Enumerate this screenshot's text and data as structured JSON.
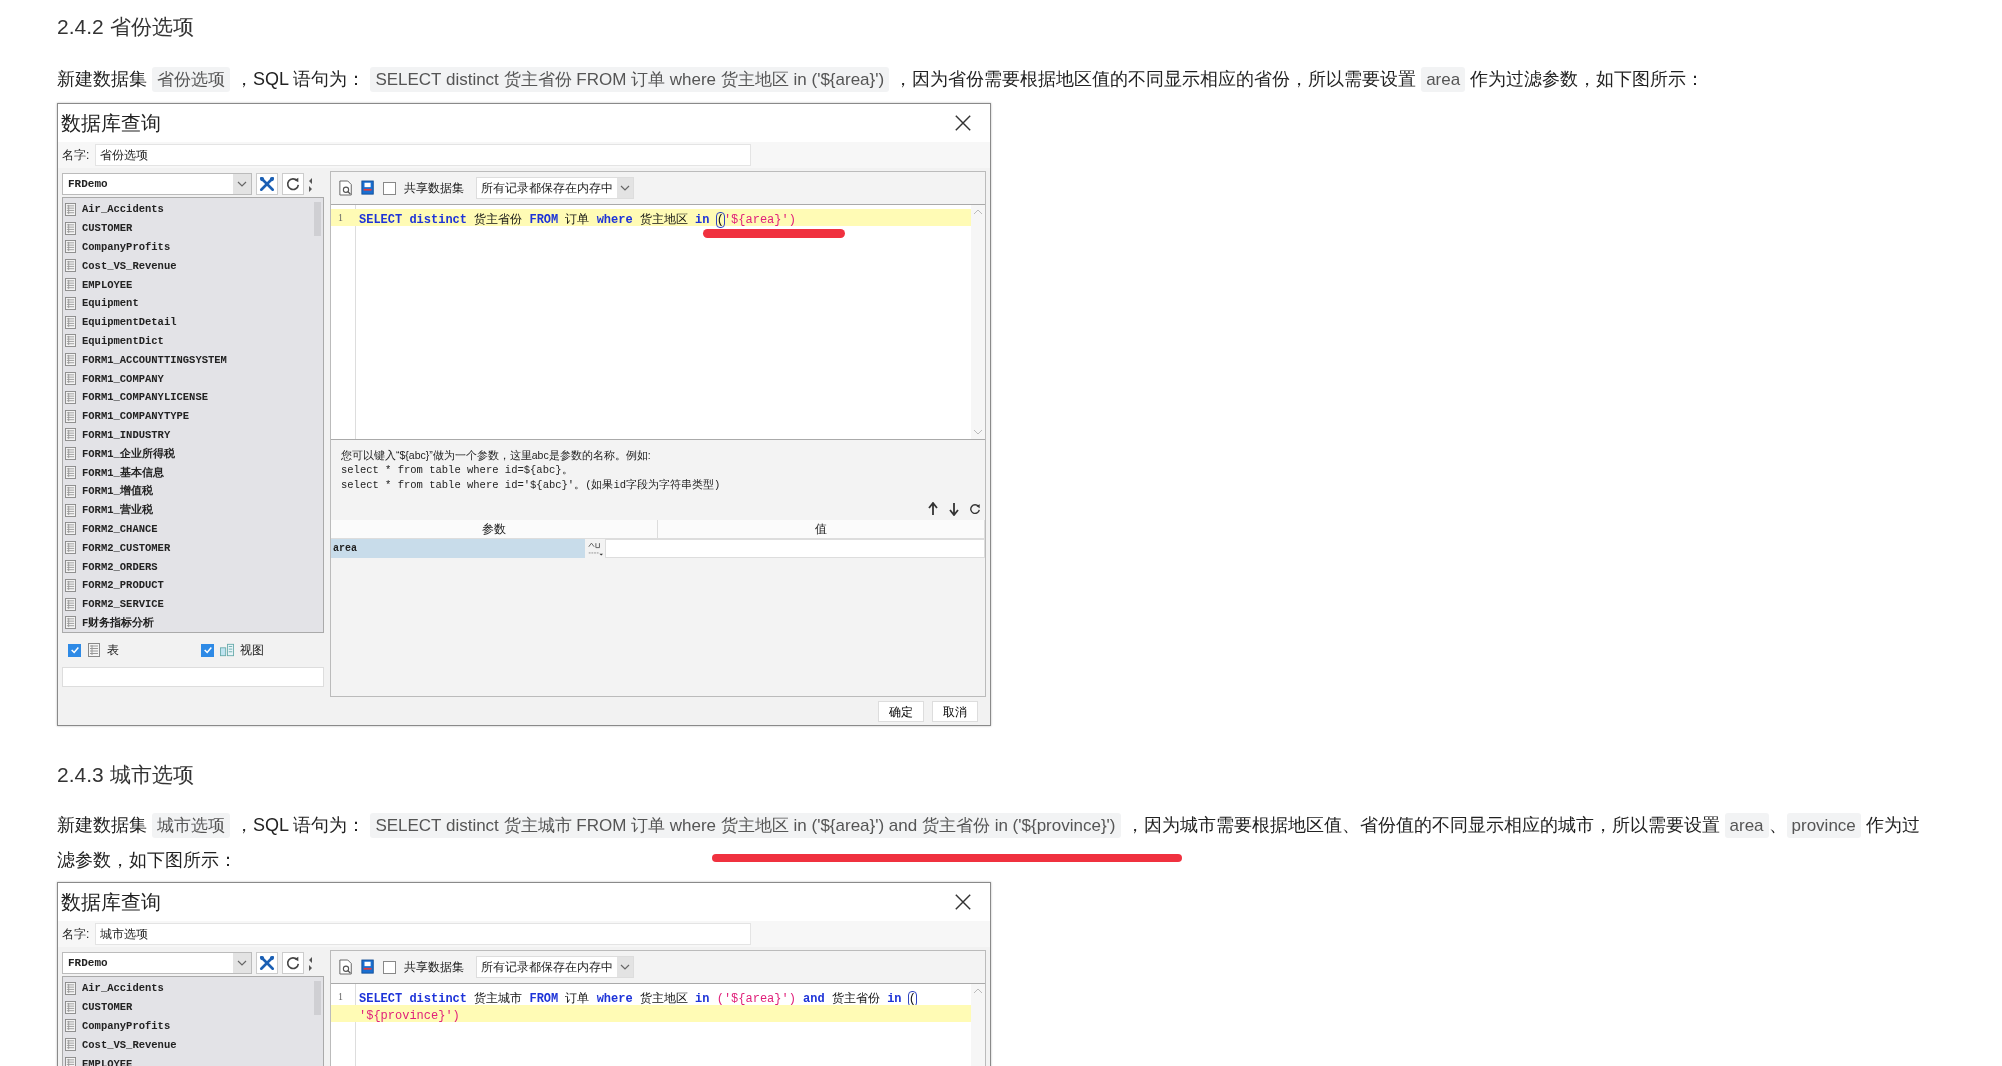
{
  "sections": [
    {
      "heading": "2.4.2 省份选项",
      "paragraph": [
        {
          "kind": "text",
          "text": "新建数据集 "
        },
        {
          "kind": "code",
          "text": "省份选项"
        },
        {
          "kind": "text",
          "text": " ，SQL 语句为： "
        },
        {
          "kind": "code",
          "text": "SELECT distinct 货主省份 FROM 订单 where 货主地区 in ('${area}')"
        },
        {
          "kind": "text",
          "text": " ，因为省份需要根据地区值的不同显示相应的省份，所以需要设置 "
        },
        {
          "kind": "code",
          "text": "area"
        },
        {
          "kind": "text",
          "text": " 作为过滤参数，如下图所示："
        }
      ],
      "dialog": {
        "title": "数据库查询",
        "name_label": "名字:",
        "name": "省份选项",
        "datasource": "FRDemo",
        "tables": [
          "Air_Accidents",
          "CUSTOMER",
          "CompanyProfits",
          "Cost_VS_Revenue",
          "EMPLOYEE",
          "Equipment",
          "EquipmentDetail",
          "EquipmentDict",
          "FORM1_ACCOUNTTINGSYSTEM",
          "FORM1_COMPANY",
          "FORM1_COMPANYLICENSE",
          "FORM1_COMPANYTYPE",
          "FORM1_INDUSTRY",
          "FORM1_企业所得税",
          "FORM1_基本信息",
          "FORM1_增值税",
          "FORM1_营业税",
          "FORM2_CHANCE",
          "FORM2_CUSTOMER",
          "FORM2_ORDERS",
          "FORM2_PRODUCT",
          "FORM2_SERVICE",
          "F财务指标分析"
        ],
        "filters": [
          {
            "kind": "table",
            "label": "表",
            "checked": true
          },
          {
            "kind": "view",
            "label": "视图",
            "checked": true
          }
        ],
        "share": {
          "label": "共享数据集",
          "checked": false
        },
        "cache_mode": "所有记录都保存在内存中",
        "red_mark": true,
        "sql_lines": [
          {
            "line": "1",
            "current": true,
            "tokens": [
              {
                "kind": "kw",
                "text": "SELECT distinct"
              },
              {
                "kind": "text",
                "text": "货主省份"
              },
              {
                "kind": "kw",
                "text": "FROM"
              },
              {
                "kind": "text",
                "text": "订单"
              },
              {
                "kind": "kw",
                "text": "where"
              },
              {
                "kind": "text",
                "text": "货主地区"
              },
              {
                "kind": "kw",
                "text": "in"
              },
              {
                "kind": "bracket",
                "text": "("
              },
              {
                "kind": "str",
                "text": "'${area}')"
              }
            ]
          }
        ],
        "hint": [
          "您可以键入“${abc}”做为一个参数，这里abc是参数的名称。例如:",
          "select * from table where id=${abc}。",
          "select * from table where id='${abc}'。(如果id字段为字符串类型)"
        ],
        "param_columns": [
          "参数",
          "值"
        ],
        "params": [
          {
            "name": "area",
            "selected": true
          }
        ],
        "buttons": [
          "确定",
          "取消"
        ]
      }
    },
    {
      "heading": "2.4.3 城市选项",
      "red_mark": true,
      "paragraph": [
        {
          "kind": "text",
          "text": "新建数据集 "
        },
        {
          "kind": "code",
          "text": "城市选项"
        },
        {
          "kind": "text",
          "text": " ，SQL 语句为： "
        },
        {
          "kind": "code",
          "text": "SELECT distinct 货主城市 FROM 订单 where 货主地区 in ('${area}') and 货主省份 in ('${province}')"
        },
        {
          "kind": "text",
          "text": " ，因为城市需要根据地区值、省份值的不同显示相应的城市，所以需要设置 "
        },
        {
          "kind": "code",
          "text": "area"
        },
        {
          "kind": "text",
          "text": "、"
        },
        {
          "kind": "code",
          "text": "province"
        },
        {
          "kind": "text",
          "text": " 作为过滤参数，如下图所示："
        }
      ],
      "dialog": {
        "title": "数据库查询",
        "name_label": "名字:",
        "name": "城市选项",
        "datasource": "FRDemo",
        "tables": [
          "Air_Accidents",
          "CUSTOMER",
          "CompanyProfits",
          "Cost_VS_Revenue",
          "EMPLOYEE"
        ],
        "share": {
          "label": "共享数据集",
          "checked": false
        },
        "cache_mode": "所有记录都保存在内存中",
        "sql_lines": [
          {
            "line": "1",
            "current": false,
            "tokens": [
              {
                "kind": "kw",
                "text": "SELECT distinct"
              },
              {
                "kind": "text",
                "text": "货主城市"
              },
              {
                "kind": "kw",
                "text": "FROM"
              },
              {
                "kind": "text",
                "text": "订单"
              },
              {
                "kind": "kw",
                "text": "where"
              },
              {
                "kind": "text",
                "text": "货主地区"
              },
              {
                "kind": "kw",
                "text": "in"
              },
              {
                "kind": "str",
                "text": "('${area}')"
              },
              {
                "kind": "kw",
                "text": "and"
              },
              {
                "kind": "text",
                "text": "货主省份"
              },
              {
                "kind": "kw",
                "text": "in"
              },
              {
                "kind": "bracket",
                "text": "("
              }
            ]
          },
          {
            "current": true,
            "tokens": [
              {
                "kind": "str",
                "text": "'${province}')"
              }
            ]
          }
        ]
      }
    }
  ]
}
